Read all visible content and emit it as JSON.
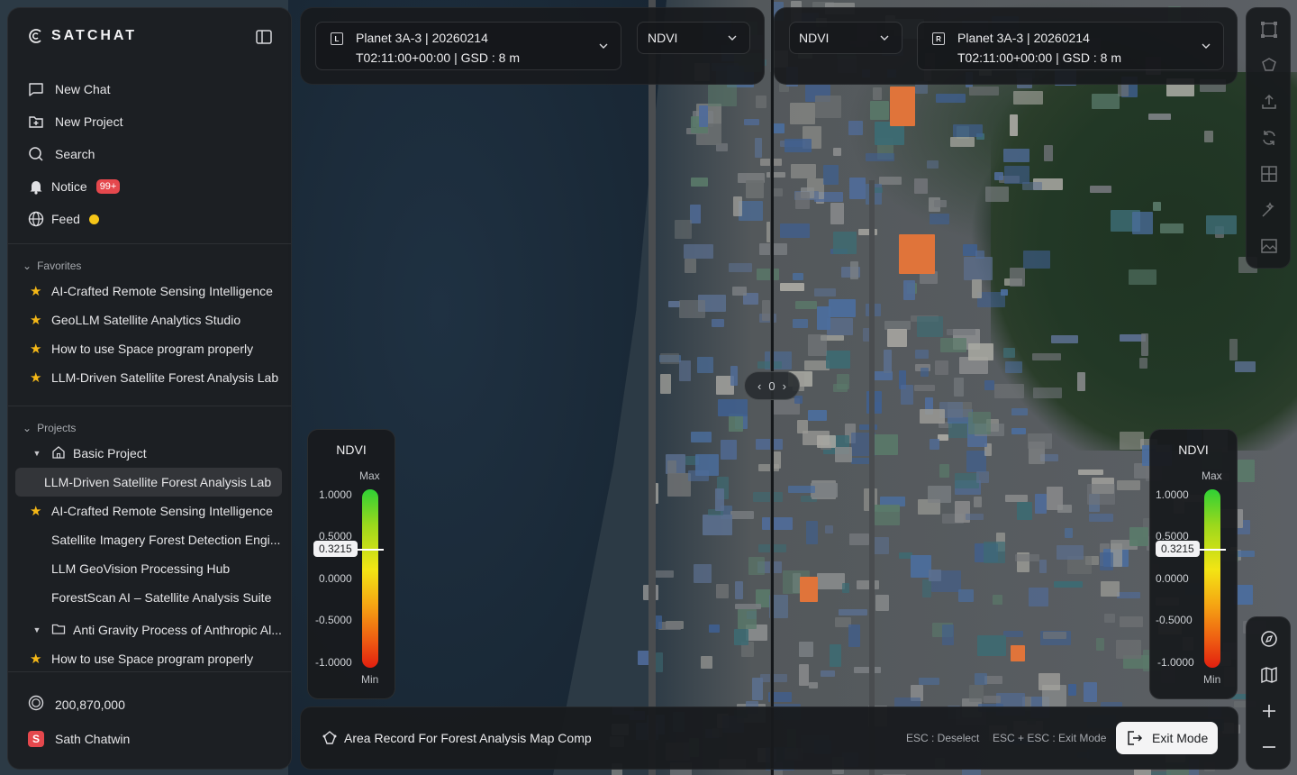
{
  "brand": {
    "name": "SATCHAT"
  },
  "nav": {
    "new_chat": "New Chat",
    "new_project": "New Project",
    "search": "Search",
    "notice": "Notice",
    "notice_badge": "99+",
    "feed": "Feed"
  },
  "favorites": {
    "title": "Favorites",
    "items": [
      "AI-Crafted Remote Sensing Intelligence",
      "GeoLLM Satellite Analytics Studio",
      "How to use Space program properly",
      "LLM-Driven Satellite Forest Analysis Lab"
    ]
  },
  "projects": {
    "title": "Projects",
    "basic_project": "Basic Project",
    "items": [
      "LLM-Driven Satellite Forest Analysis Lab",
      "AI-Crafted Remote Sensing Intelligence",
      "Satellite Imagery Forest Detection Engi...",
      "LLM GeoVision Processing Hub",
      "ForestScan AI – Satellite Analysis Suite"
    ],
    "folder": "Anti Gravity Process of Anthropic Al...",
    "folder_item": "How to use Space program properly"
  },
  "footer": {
    "credits": "200,870,000",
    "user": "Sath Chatwin",
    "user_initial": "S"
  },
  "left_image": {
    "letter": "L",
    "line1": "Planet 3A-3  |  20260214",
    "line2": "T02:11:00+00:00  |  GSD : 8 m",
    "index": "NDVI"
  },
  "right_image": {
    "letter": "R",
    "line1": "Planet 3A-3  |  20260214",
    "line2": "T02:11:00+00:00  |  GSD : 8 m",
    "index": "NDVI"
  },
  "legend": {
    "title": "NDVI",
    "max_label": "Max",
    "min_label": "Min",
    "ticks": [
      "1.0000",
      "0.5000",
      "0.0000",
      "-0.5000",
      "-1.0000"
    ],
    "current": "0.3215",
    "current_value": 0.3215,
    "range": [
      -1.0,
      1.0
    ]
  },
  "split_handle": {
    "glyph": "0"
  },
  "bottom": {
    "title": "Area Record For Forest Analysis Map Comp",
    "hint_deselect": "ESC : Deselect",
    "hint_exit": "ESC + ESC : Exit Mode",
    "exit_button": "Exit Mode"
  },
  "icons": {
    "toolbar": [
      "bbox-icon",
      "polygon-icon",
      "upload-icon",
      "refresh-icon",
      "grid-icon",
      "magic-wand-icon",
      "compare-image-icon"
    ],
    "zoom": [
      "compass-icon",
      "map-icon",
      "zoom-in-icon",
      "zoom-out-icon"
    ]
  },
  "colors": {
    "accent_red": "#e5484d",
    "star": "#f5b817",
    "feed_dot": "#f5c518"
  }
}
